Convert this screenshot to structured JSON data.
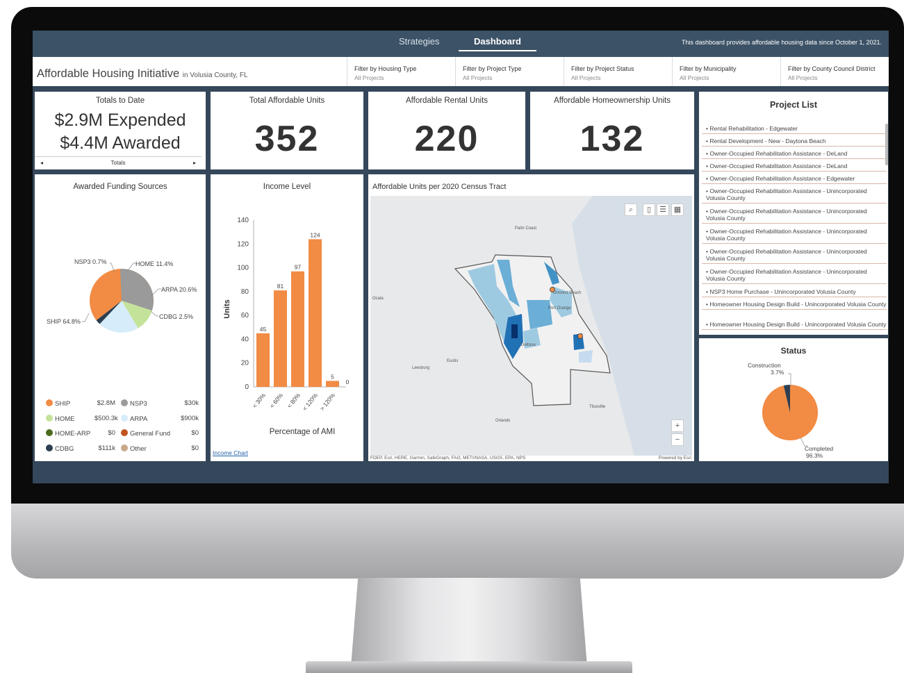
{
  "nav": {
    "tabs": [
      {
        "label": "Strategies"
      },
      {
        "label": "Dashboard"
      }
    ],
    "note": "This dashboard provides affordable housing data since October 1, 2021."
  },
  "header": {
    "title": "Affordable Housing Initiative",
    "subtitle": "in Volusia County, FL"
  },
  "filters": [
    {
      "label": "Filter by Housing Type",
      "value": "All Projects"
    },
    {
      "label": "Filter by Project Type",
      "value": "All Projects"
    },
    {
      "label": "Filter by Project Status",
      "value": "All Projects"
    },
    {
      "label": "Filter by Municipality",
      "value": "All Projects"
    },
    {
      "label": "Filter by County Council District",
      "value": "All Projects"
    }
  ],
  "totals": {
    "title": "Totals to Date",
    "expended": "$2.9M Expended",
    "awarded": "$4.4M Awarded",
    "nav_label": "Totals"
  },
  "units": {
    "total": {
      "title": "Total Affordable Units",
      "value": "352"
    },
    "rental": {
      "title": "Affordable Rental Units",
      "value": "220"
    },
    "homeownership": {
      "title": "Affordable Homeownership Units",
      "value": "132"
    }
  },
  "funding": {
    "title": "Awarded Funding Sources",
    "pie_labels": {
      "nsp3": "NSP3 0.7%",
      "home": "HOME 11.4%",
      "arpa": "ARPA 20.6%",
      "cdbg": "CDBG 2.5%",
      "ship": "SHIP 64.8%"
    },
    "legend": [
      {
        "name": "SHIP",
        "amount": "$2.8M",
        "color": "#f28b43"
      },
      {
        "name": "NSP3",
        "amount": "$30k",
        "color": "#9a9a9a"
      },
      {
        "name": "HOME",
        "amount": "$500.3k",
        "color": "#c5e29a"
      },
      {
        "name": "ARPA",
        "amount": "$900k",
        "color": "#d6ecfa"
      },
      {
        "name": "HOME-ARP",
        "amount": "$0",
        "color": "#4d6b1e"
      },
      {
        "name": "General Fund",
        "amount": "$0",
        "color": "#c0541e"
      },
      {
        "name": "CDBG",
        "amount": "$111k",
        "color": "#2d3e50"
      },
      {
        "name": "Other",
        "amount": "$0",
        "color": "#c8a98a"
      }
    ]
  },
  "chart_data": {
    "type": "bar",
    "title": "Income Level",
    "xlabel": "Percentage of AMI",
    "ylabel": "Units",
    "categories": [
      "< 30%",
      "< 60%",
      "< 80%",
      "< 120%",
      "> 120%"
    ],
    "values": [
      45,
      81,
      97,
      124,
      5
    ],
    "extra_label": "0",
    "ylim": [
      0,
      140
    ],
    "yticks": [
      0,
      20,
      40,
      60,
      80,
      100,
      120,
      140
    ],
    "bar_color": "#f28b43"
  },
  "income_link": "Income Chart",
  "map": {
    "title": "Affordable Units per 2020 Census Tract",
    "attribution": "FDEP, Esri, HERE, Garmin, SafeGraph, FAO, METI/NASA, USGS, EPA, NPS",
    "powered": "Powered by Esri",
    "places": [
      "Palm Coast",
      "Ormond Beach",
      "Port Orange",
      "Ocala",
      "Deltona",
      "Eustis",
      "Leesburg",
      "Orlando",
      "Titusville"
    ],
    "zoom_in": "+",
    "zoom_out": "−"
  },
  "project_list": {
    "title": "Project List",
    "items": [
      "Rental Rehabilitation - Edgewater",
      "Rental Development - New - Daytona Beach",
      "Owner-Occupied Rehabilitation Assistance - DeLand",
      "Owner-Occupied Rehabilitation Assistance - DeLand",
      "Owner-Occupied Rehabilitation Assistance - Edgewater",
      "Owner-Occupied Rehabilitation Assistance - Unincorporated Volusia County",
      "Owner-Occupied Rehabilitation Assistance - Unincorporated Volusia County",
      "Owner-Occupied Rehabilitation Assistance - Unincorporated Volusia County",
      "Owner-Occupied Rehabilitation Assistance - Unincorporated Volusia County",
      "Owner-Occupied Rehabilitation Assistance - Unincorporated Volusia County",
      "NSP3 Home Purchase - Unincorporated Volusia County",
      "Homeowner Housing Design Build - Unincorporated Volusia County",
      "Homeowner Housing Design Build - Unincorporated Volusia County"
    ]
  },
  "status": {
    "title": "Status",
    "construction_label": "Construction",
    "construction_pct": "3.7%",
    "completed_label": "Completed",
    "completed_pct": "96.3%",
    "construction_value": 3.7,
    "completed_value": 96.3
  }
}
